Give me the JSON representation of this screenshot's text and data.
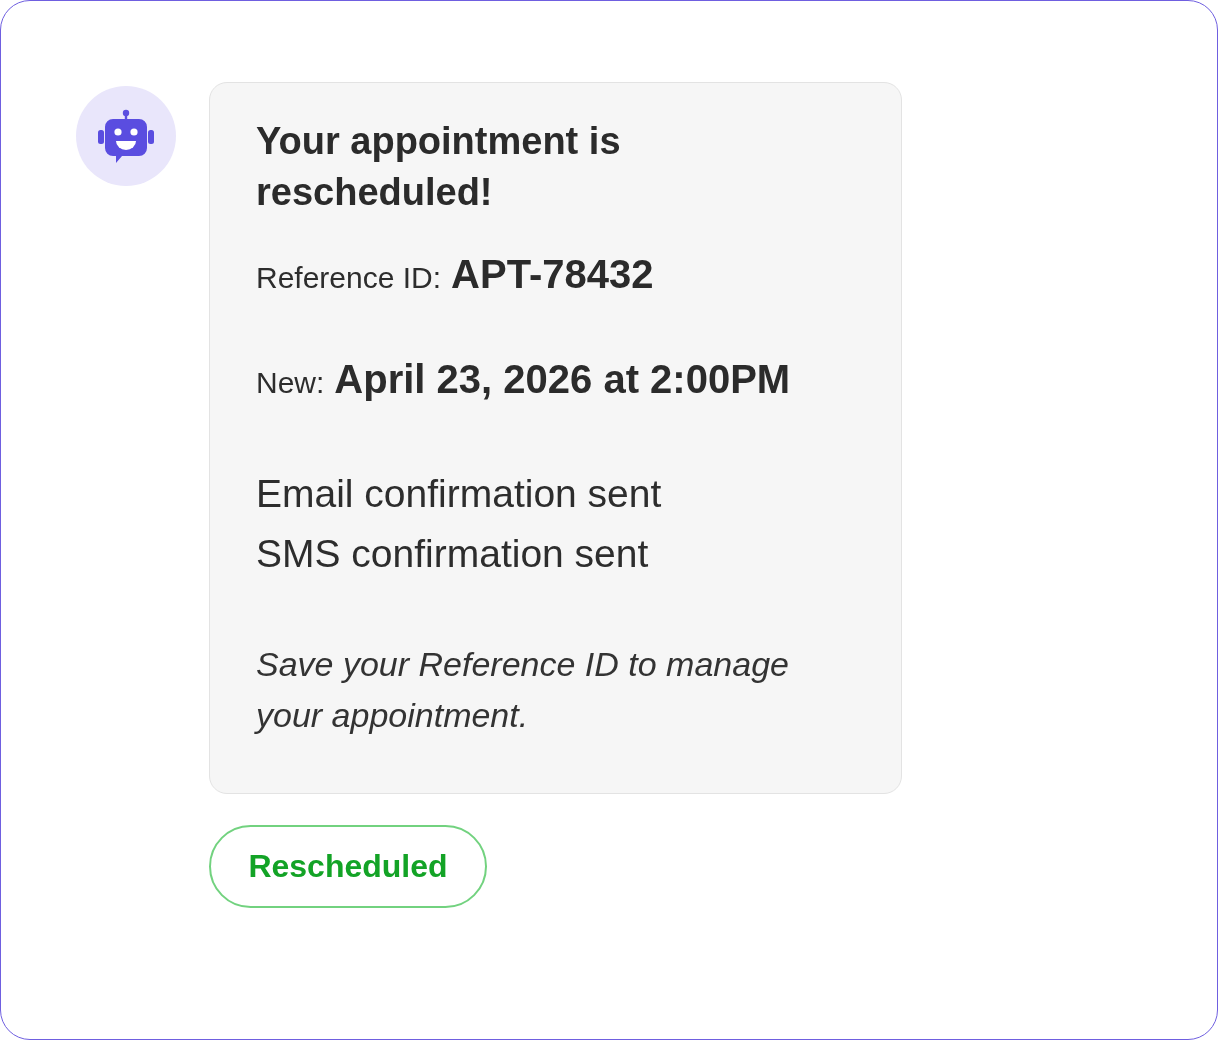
{
  "message": {
    "title": "Your appointment is rescheduled!",
    "details": [
      {
        "label": "Reference ID:",
        "value": "APT-78432"
      },
      {
        "label": "New:",
        "value": "April 23, 2026 at 2:00PM"
      }
    ],
    "confirmations": [
      "Email confirmation sent",
      "SMS confirmation sent"
    ],
    "note": "Save your Reference ID to manage your appointment."
  },
  "status": {
    "label": "Rescheduled"
  }
}
